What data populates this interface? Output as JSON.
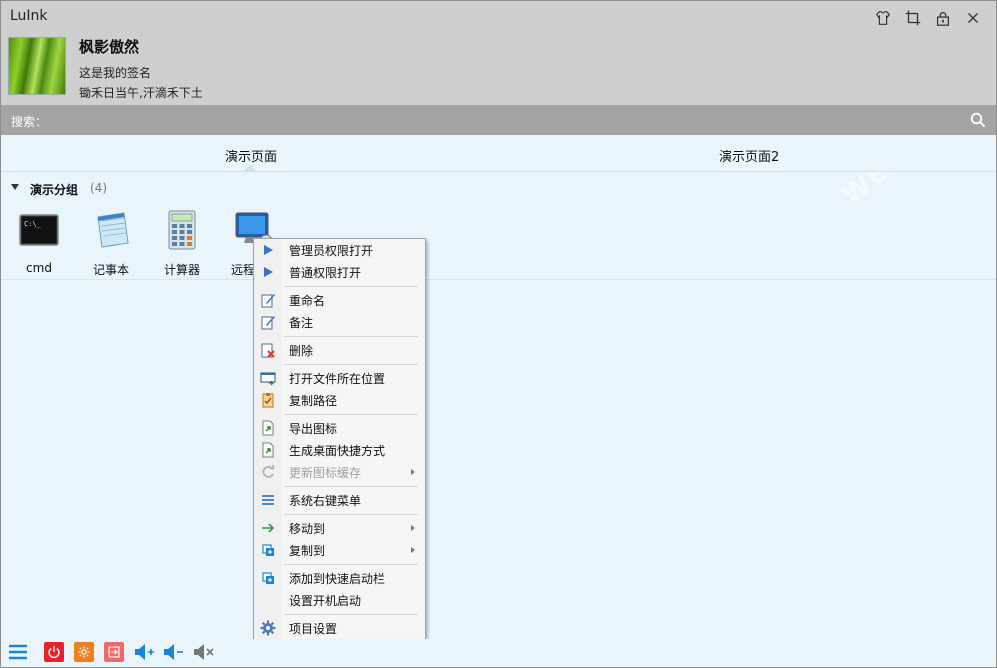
{
  "window": {
    "title": "LuInk"
  },
  "title_icons": [
    "skin-icon",
    "crop-icon",
    "lock-icon",
    "close-icon"
  ],
  "user": {
    "name": "枫影傲然",
    "signature": "这是我的签名",
    "motto": "锄禾日当午,汗滴禾下土"
  },
  "search": {
    "label": "搜索：",
    "value": "",
    "placeholder": ""
  },
  "tabs": [
    {
      "label": "演示页面"
    },
    {
      "label": "演示页面2"
    }
  ],
  "group": {
    "name": "演示分组",
    "count": "(4)"
  },
  "apps": [
    {
      "label": "cmd",
      "icon": "terminal-icon"
    },
    {
      "label": "记事本",
      "icon": "notepad-icon"
    },
    {
      "label": "计算器",
      "icon": "calculator-icon"
    },
    {
      "label": "远程",
      "icon": "remote-desktop-icon"
    }
  ],
  "context_menu": {
    "items": [
      {
        "label": "管理员权限打开",
        "icon": "play-icon"
      },
      {
        "label": "普通权限打开",
        "icon": "play-icon"
      },
      {
        "label": "重命名",
        "icon": "rename-icon"
      },
      {
        "label": "备注",
        "icon": "note-icon"
      },
      {
        "label": "删除",
        "icon": "delete-icon"
      },
      {
        "label": "打开文件所在位置",
        "icon": "open-location-icon"
      },
      {
        "label": "复制路径",
        "icon": "copy-path-icon"
      },
      {
        "label": "导出图标",
        "icon": "export-icon"
      },
      {
        "label": "生成桌面快捷方式",
        "icon": "shortcut-icon"
      },
      {
        "label": "更新图标缓存",
        "icon": "refresh-icon",
        "disabled": true,
        "submenu": true
      },
      {
        "label": "系统右键菜单",
        "icon": "menu-icon"
      },
      {
        "label": "移动到",
        "icon": "move-arrow-icon",
        "submenu": true
      },
      {
        "label": "复制到",
        "icon": "copy-to-icon",
        "submenu": true
      },
      {
        "label": "添加到快速启动栏",
        "icon": "quick-launch-icon"
      },
      {
        "label": "设置开机启动",
        "icon": ""
      },
      {
        "label": "项目设置",
        "icon": "gear-icon"
      }
    ]
  },
  "bottom_bar": [
    "menu-icon",
    "power-icon",
    "restart-icon",
    "logout-icon",
    "volume-up-icon",
    "volume-down-icon",
    "mute-icon"
  ],
  "watermark": {
    "text": "WEIDOWN.COM"
  },
  "colors": {
    "header_bg": "#cfcfcf",
    "search_bg": "#a4a4a4",
    "body_bg": "#eaf4fb",
    "power": "#e8212b",
    "restart": "#f07f1c",
    "logout": "#f06a6a",
    "speaker": "#1a86d8"
  }
}
